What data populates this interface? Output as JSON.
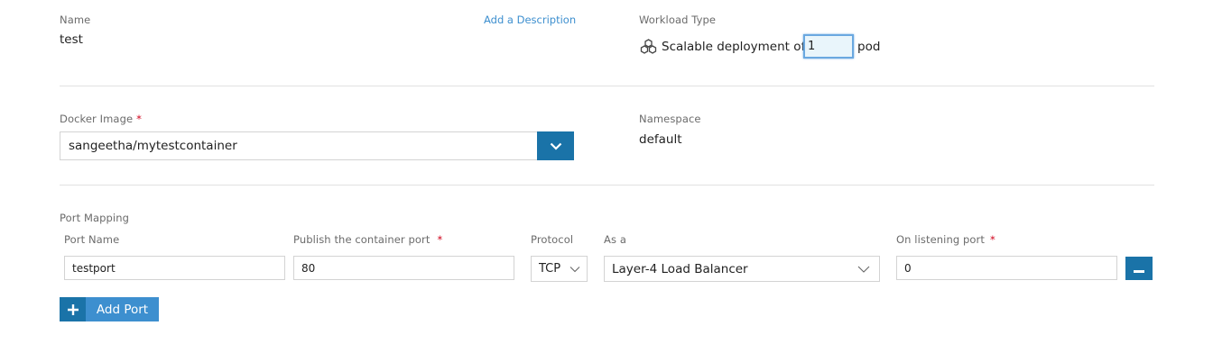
{
  "name": {
    "label": "Name",
    "value": "test",
    "add_description": "Add a Description"
  },
  "workload": {
    "label": "Workload Type",
    "icon": "cluster-icon",
    "prefix": "Scalable deployment of",
    "count": "1",
    "suffix": "pod"
  },
  "docker": {
    "label": "Docker Image",
    "required": "*",
    "value": "sangeetha/mytestcontainer"
  },
  "namespace": {
    "label": "Namespace",
    "value": "default"
  },
  "ports": {
    "section_label": "Port Mapping",
    "headers": {
      "port_name": "Port Name",
      "container_port": "Publish the container port",
      "protocol": "Protocol",
      "as_a": "As a",
      "listening_port": "On listening port"
    },
    "required": "*",
    "row": {
      "port_name": "testport",
      "container_port": "80",
      "protocol": "TCP",
      "as_a": "Layer-4 Load Balancer",
      "listening_port": "0"
    },
    "add_port": "Add Port"
  },
  "colors": {
    "accent": "#1a73a8",
    "accent_light": "#3d8fcf",
    "required": "#d0021b"
  }
}
